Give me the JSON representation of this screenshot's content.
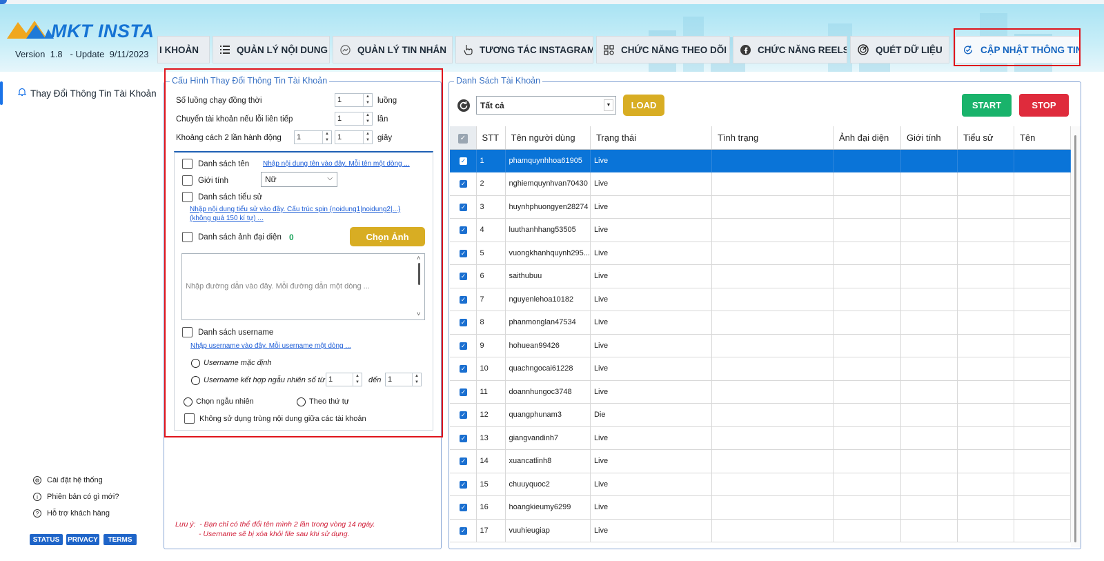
{
  "app": {
    "logo_text": "MKT INSTA",
    "version": "Version  1.8   - Update  9/11/2023",
    "accent": "#1565c0"
  },
  "tabs": [
    {
      "label": "I KHOẢN",
      "icon": "none"
    },
    {
      "label": "QUẢN LÝ NỘI DUNG",
      "icon": "list-icon"
    },
    {
      "label": "QUẢN LÝ TIN NHẮN",
      "icon": "messenger-icon"
    },
    {
      "label": "TƯƠNG TÁC INSTAGRAM",
      "icon": "hand-pointer-icon"
    },
    {
      "label": "CHỨC NĂNG THEO DÕI",
      "icon": "grid-users-icon"
    },
    {
      "label": "CHỨC NĂNG REELS",
      "icon": "facebook-icon"
    },
    {
      "label": "QUÉT DỮ LIỆU",
      "icon": "radar-icon"
    },
    {
      "label": "CẬP NHẬT THÔNG TIN",
      "icon": "refresh-check-icon"
    }
  ],
  "sidebar": {
    "item": "Thay Đổi Thông Tin Tài Khoản",
    "footer": [
      {
        "label": "Cài đặt hệ thống",
        "icon": "gear-icon"
      },
      {
        "label": "Phiên bản có gì mới?",
        "icon": "info-icon"
      },
      {
        "label": "Hỗ trợ khách hàng",
        "icon": "help-icon"
      }
    ],
    "pills": [
      "STATUS",
      "PRIVACY",
      "TERMS"
    ]
  },
  "config": {
    "legend": "Cấu Hình Thay Đổi Thông Tin Tài Khoản",
    "threads_label": "Số luồng chạy đồng thời",
    "threads_value": "1",
    "threads_unit": "luồng",
    "switch_label": "Chuyển tài khoản nếu lỗi liên tiếp",
    "switch_value": "1",
    "switch_unit": "lần",
    "delay_label": "Khoảng cách 2 lần hành động",
    "delay_min": "1",
    "delay_max": "1",
    "delay_unit": "giây",
    "names_label": "Danh sách tên",
    "names_link": "Nhập nội dung tên vào đây. Mỗi tên một dòng ...",
    "gender_label": "Giới tính",
    "gender_value": "Nữ",
    "bio_label": "Danh sách tiểu sử",
    "bio_link_1": "Nhập nội dung tiểu sử vào đây. Cấu trúc spin {noidung1|noidung2|...}",
    "bio_link_2": "(không quá 150 kí tự) ...",
    "avatar_label": "Danh sách ảnh đại diện",
    "avatar_count": "0",
    "choose_image": "Chọn Ảnh",
    "path_placeholder": "Nhập đường dẫn vào đây. Mỗi đường dẫn một dòng ...",
    "username_label": "Danh sách username",
    "username_link": "Nhập username vào đây. Mỗi username một dòng ...",
    "username_default": "Username mặc định",
    "username_random": "Username kết hợp ngẫu nhiên số từ :",
    "random_from": "1",
    "random_to_label": "đến",
    "random_to": "1",
    "pick_random": "Chọn ngẫu nhiên",
    "pick_order": "Theo thứ tự",
    "no_duplicate": "Không sử dụng trùng nội dung giữa các tài khoản",
    "note_1": "Lưu ý:  - Bạn chỉ có thể đổi tên mình 2 lần trong vòng 14 ngày.",
    "note_2": "- Username sẽ bị xóa khỏi file sau khi sử dụng."
  },
  "accounts": {
    "legend": "Danh Sách Tài Khoản",
    "filter_value": "Tất cả",
    "load_label": "LOAD",
    "start_label": "START",
    "stop_label": "STOP",
    "start_color": "#19b36b",
    "stop_color": "#df2b3c",
    "columns": [
      "STT",
      "Tên người dùng",
      "Trạng thái",
      "Tình trạng",
      "Ảnh đại diện",
      "Giới tính",
      "Tiểu sử",
      "Tên"
    ],
    "rows": [
      {
        "stt": "1",
        "user": "phamquynhhoa61905",
        "status": "Live"
      },
      {
        "stt": "2",
        "user": "nghiemquynhvan70430",
        "status": "Live"
      },
      {
        "stt": "3",
        "user": "huynhphuongyen28274",
        "status": "Live"
      },
      {
        "stt": "4",
        "user": "luuthanhhang53505",
        "status": "Live"
      },
      {
        "stt": "5",
        "user": "vuongkhanhquynh295...",
        "status": "Live"
      },
      {
        "stt": "6",
        "user": "saithubuu",
        "status": "Live"
      },
      {
        "stt": "7",
        "user": "nguyenlehoa10182",
        "status": "Live"
      },
      {
        "stt": "8",
        "user": "phanmonglan47534",
        "status": "Live"
      },
      {
        "stt": "9",
        "user": "hohuean99426",
        "status": "Live"
      },
      {
        "stt": "10",
        "user": "quachngocai61228",
        "status": "Live"
      },
      {
        "stt": "11",
        "user": "doannhungoc3748",
        "status": "Live"
      },
      {
        "stt": "12",
        "user": "quangphunam3",
        "status": "Die"
      },
      {
        "stt": "13",
        "user": "giangvandinh7",
        "status": "Live"
      },
      {
        "stt": "14",
        "user": "xuancatlinh8",
        "status": "Live"
      },
      {
        "stt": "15",
        "user": "chuuyquoc2",
        "status": "Live"
      },
      {
        "stt": "16",
        "user": "hoangkieumy6299",
        "status": "Live"
      },
      {
        "stt": "17",
        "user": "vuuhieugiap",
        "status": "Live"
      }
    ]
  }
}
